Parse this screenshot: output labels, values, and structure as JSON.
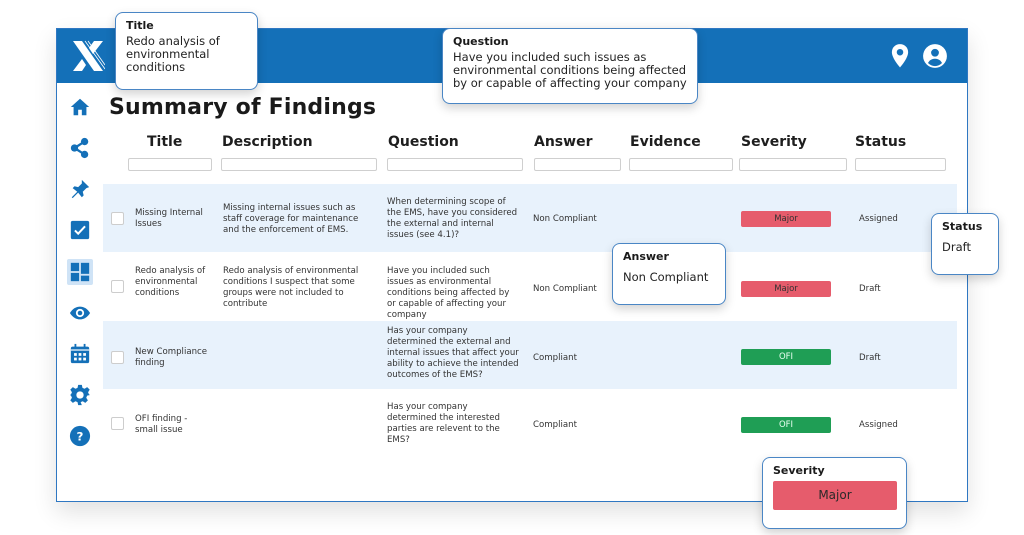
{
  "app": {
    "logo": "x-logo-icon",
    "header_icons": [
      "location-pin-icon",
      "user-account-icon"
    ]
  },
  "page": {
    "title": "Summary of Findings"
  },
  "sidebar": {
    "items": [
      {
        "name": "home",
        "icon": "home-icon"
      },
      {
        "name": "share",
        "icon": "share-icon"
      },
      {
        "name": "pin",
        "icon": "pushpin-icon"
      },
      {
        "name": "tasks",
        "icon": "checkbox-icon"
      },
      {
        "name": "dashboard",
        "icon": "dashboard-icon",
        "active": true
      },
      {
        "name": "view",
        "icon": "eye-icon"
      },
      {
        "name": "calendar",
        "icon": "calendar-icon"
      },
      {
        "name": "settings",
        "icon": "gear-icon"
      },
      {
        "name": "help",
        "icon": "help-icon",
        "glyph": "?"
      }
    ]
  },
  "table": {
    "columns": [
      "Title",
      "Description",
      "Question",
      "Answer",
      "Evidence",
      "Severity",
      "Status"
    ],
    "rows": [
      {
        "title": "Missing Internal Issues",
        "description": "Missing internal issues such as staff coverage for maintenance and the enforcement of EMS.",
        "question": "When determining scope of the EMS, have you considered the external and internal issues (see 4.1)?",
        "answer": "Non Compliant",
        "evidence": "",
        "severity": "Major",
        "status": "Assigned"
      },
      {
        "title": "Redo analysis of environmental conditions",
        "description": "Redo analysis of environmental conditions I suspect that some groups were not included to contribute",
        "question": "Have you included such issues as environmental conditions being affected by or capable of affecting your company",
        "answer": "Non Compliant",
        "evidence": "",
        "severity": "Major",
        "status": "Draft"
      },
      {
        "title": "New Compliance finding",
        "description": "",
        "question": "Has your company determined the external and internal issues that affect your ability to achieve the intended outcomes of the EMS?",
        "answer": "Compliant",
        "evidence": "",
        "severity": "OFI",
        "status": "Draft"
      },
      {
        "title": "OFI finding - small issue",
        "description": "",
        "question": "Has your company determined the interested parties are relevent to the EMS?",
        "answer": "Compliant",
        "evidence": "",
        "severity": "OFI",
        "status": "Assigned"
      }
    ]
  },
  "callouts": {
    "title": {
      "label": "Title",
      "value": "Redo analysis of environmental conditions"
    },
    "question": {
      "label": "Question",
      "value": "Have you included such issues as environmental conditions being affected by or capable of affecting your company"
    },
    "answer": {
      "label": "Answer",
      "value": "Non Compliant"
    },
    "status": {
      "label": "Status",
      "value": "Draft"
    },
    "severity": {
      "label": "Severity",
      "value": "Major"
    }
  },
  "colors": {
    "brand_blue": "#1470b8",
    "row_shade": "#e8f2fc",
    "major": "#e65c6c",
    "ofi": "#1f9e55"
  }
}
